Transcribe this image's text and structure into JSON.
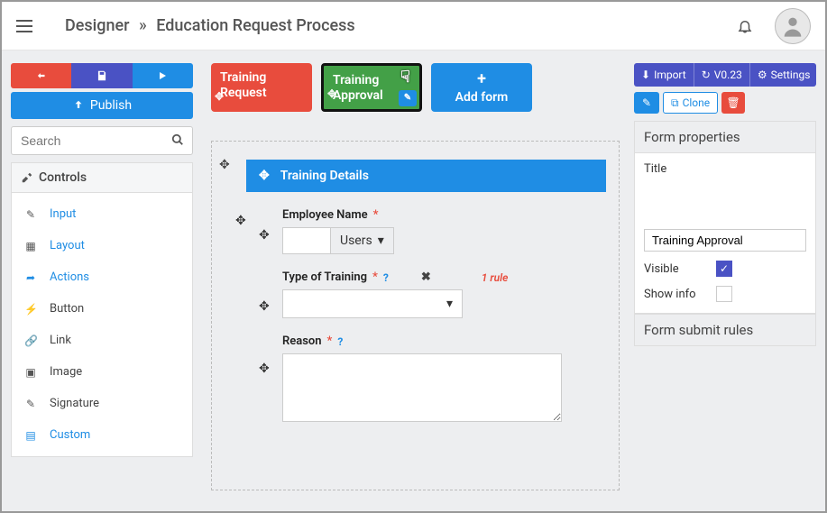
{
  "header": {
    "breadcrumb_root": "Designer",
    "breadcrumb_sep": "»",
    "breadcrumb_page": "Education Request Process"
  },
  "left": {
    "publish": "Publish",
    "search_placeholder": "Search",
    "controls_label": "Controls",
    "items": {
      "input": "Input",
      "layout": "Layout",
      "actions": "Actions",
      "button": "Button",
      "link": "Link",
      "image": "Image",
      "signature": "Signature",
      "custom": "Custom"
    }
  },
  "forms": {
    "request": "Training Request",
    "approval": "Training Approval",
    "add": "Add form"
  },
  "canvas": {
    "section_title": "Training Details",
    "fields": {
      "employee": {
        "label": "Employee Name",
        "dropdown": "Users"
      },
      "type": {
        "label": "Type of Training",
        "rule": "1 rule"
      },
      "reason": {
        "label": "Reason"
      }
    }
  },
  "right": {
    "import": "Import",
    "version": "V0.23",
    "settings": "Settings",
    "clone": "Clone",
    "props_head": "Form properties",
    "title_label": "Title",
    "title_value": "Training Approval",
    "visible_label": "Visible",
    "showinfo_label": "Show info",
    "rules_head": "Form submit rules"
  }
}
